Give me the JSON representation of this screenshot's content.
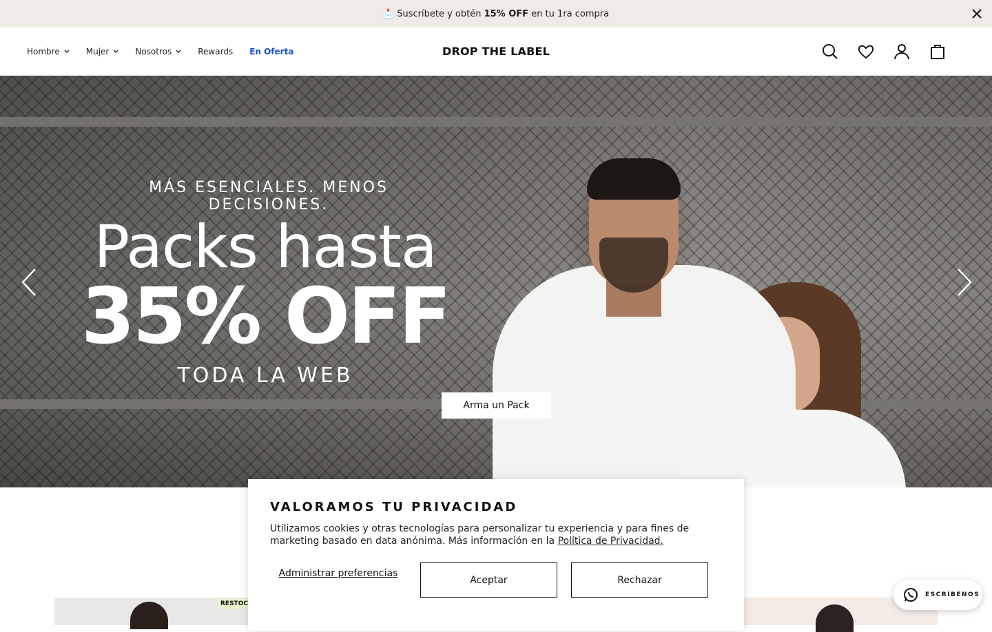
{
  "announcement": {
    "emoji": "📩",
    "text_before": "Suscríbete y obtén",
    "highlight": "15% OFF",
    "text_after": "en tu 1ra compra"
  },
  "header": {
    "nav": [
      {
        "label": "Hombre",
        "has_dropdown": true
      },
      {
        "label": "Mujer",
        "has_dropdown": true
      },
      {
        "label": "Nosotros",
        "has_dropdown": true
      },
      {
        "label": "Rewards",
        "has_dropdown": false
      },
      {
        "label": "En Oferta",
        "has_dropdown": false,
        "color": "#1a4fd6"
      }
    ],
    "logo": "DROP THE LABEL",
    "icons": [
      "search-icon",
      "heart-icon",
      "user-icon",
      "cart-icon"
    ]
  },
  "hero": {
    "kicker": "MÁS ESENCIALES. MENOS DECISIONES.",
    "headline1": "Packs hasta",
    "headline2": "35% OFF",
    "sub": "TODA LA WEB",
    "cta": "Arma un Pack"
  },
  "strip": {
    "badge": "RESTOCK"
  },
  "cookie": {
    "title": "VALORAMOS TU PRIVACIDAD",
    "body": "Utilizamos cookies y otras tecnologías para personalizar tu experiencia y para fines de marketing basado en data anónima. Más información en la",
    "link": "Política de Privacidad.",
    "manage": "Administrar preferencias",
    "accept": "Aceptar",
    "reject": "Rechazar"
  },
  "chat": {
    "label": "ESCRÍBENOS"
  },
  "colors": {
    "announcement_bg": "#efebe7",
    "sale_link": "#1a4fd6",
    "restock_badge": "#e7f7c9"
  }
}
